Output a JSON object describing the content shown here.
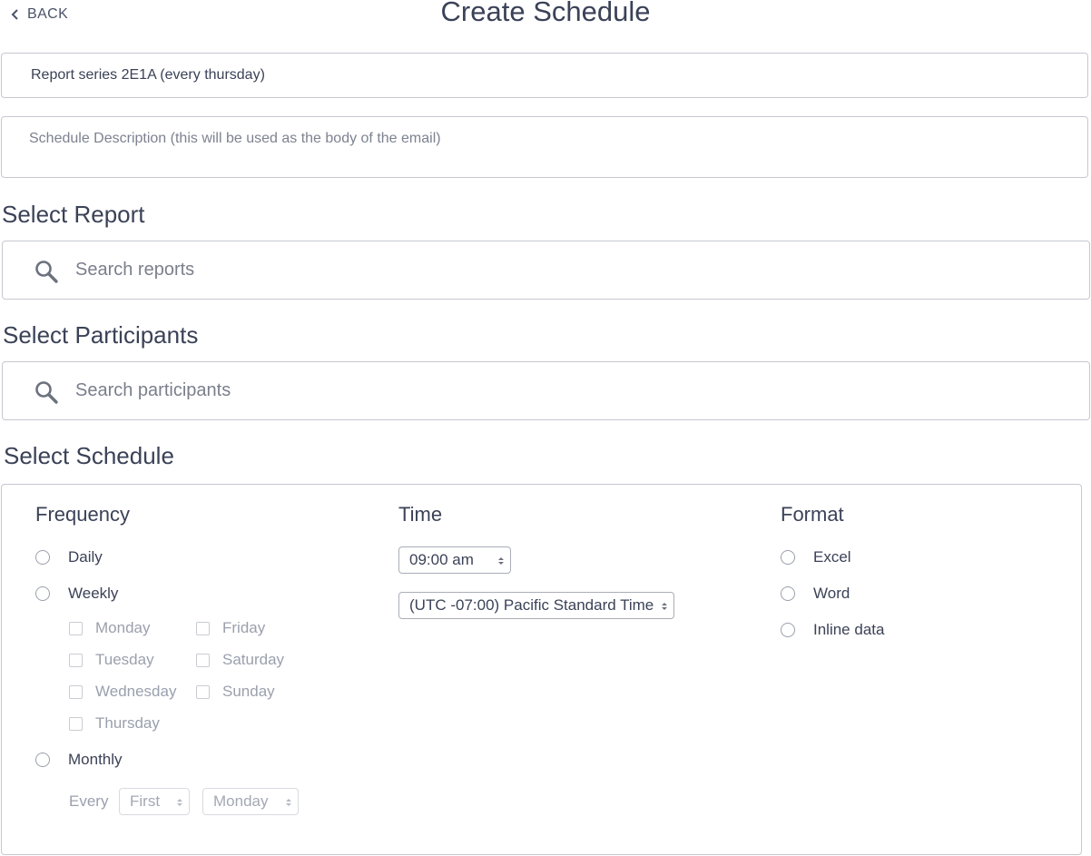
{
  "header": {
    "back_label": "BACK",
    "title": "Create Schedule"
  },
  "form": {
    "name_value": "Report series 2E1A (every thursday)",
    "description_placeholder": "Schedule Description (this will be used as the body of the email)"
  },
  "report_section": {
    "heading": "Select Report",
    "search_placeholder": "Search reports"
  },
  "participants_section": {
    "heading": "Select Participants",
    "search_placeholder": "Search participants"
  },
  "schedule_section": {
    "heading": "Select Schedule",
    "frequency": {
      "heading": "Frequency",
      "daily_label": "Daily",
      "weekly_label": "Weekly",
      "monthly_label": "Monthly",
      "days": [
        "Monday",
        "Tuesday",
        "Wednesday",
        "Thursday",
        "Friday",
        "Saturday",
        "Sunday"
      ],
      "every_label": "Every",
      "ordinal_value": "First",
      "weekday_value": "Monday"
    },
    "time": {
      "heading": "Time",
      "time_value": "09:00 am",
      "timezone_value": "(UTC -07:00) Pacific Standard Time"
    },
    "format": {
      "heading": "Format",
      "options": [
        "Excel",
        "Word",
        "Inline data"
      ]
    }
  },
  "colors": {
    "text": "#3b4257",
    "border": "#c6c8cf",
    "muted": "#9aa0ad"
  }
}
